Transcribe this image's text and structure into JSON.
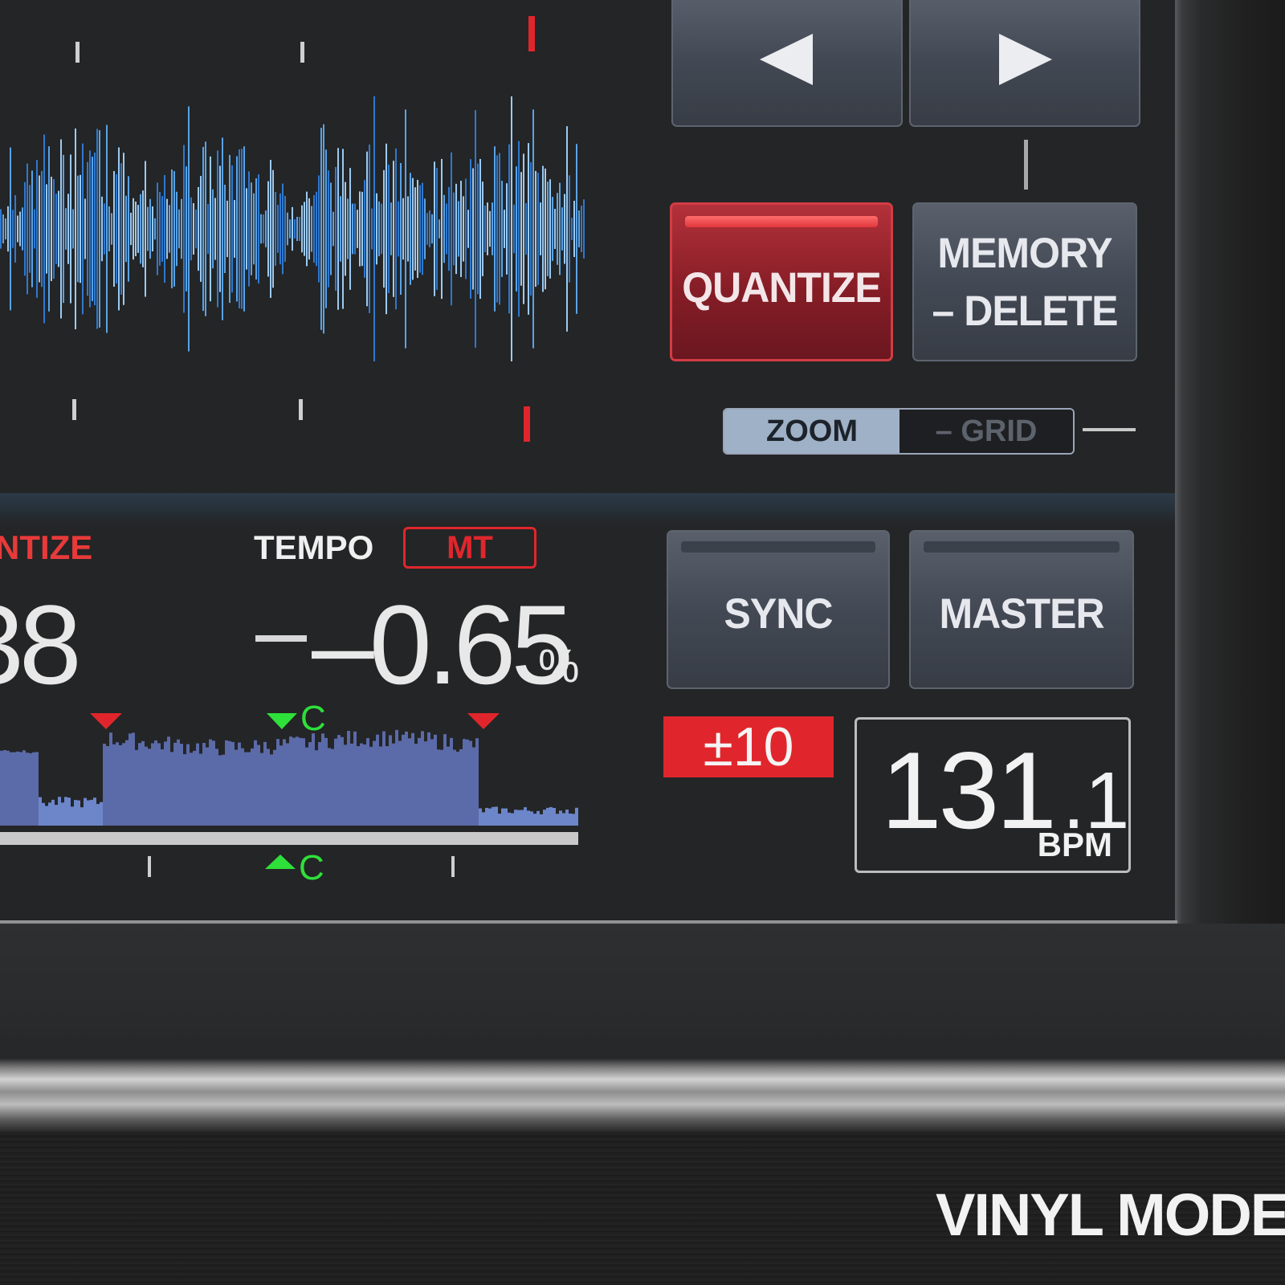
{
  "buttons": {
    "prev_icon": "left-triangle-icon",
    "next_icon": "right-triangle-icon",
    "quantize": "QUANTIZE",
    "memory_line1": "MEMORY",
    "memory_line2": "– DELETE",
    "sync": "SYNC",
    "master": "MASTER"
  },
  "zoom_grid": {
    "zoom": "ZOOM",
    "grid": "– GRID"
  },
  "status": {
    "quantize_label": "NTIZE",
    "tempo_label": "TEMPO",
    "mt_badge": "MT",
    "left_number": "38",
    "tempo_value": "–0.65",
    "tempo_unit": "%",
    "tempo_range": "±10",
    "bpm_integer": "131",
    "bpm_decimal": ".1",
    "bpm_unit": "BPM",
    "cue_marker_top": "C",
    "cue_marker_bottom": "C"
  },
  "footer": {
    "mode": "VINYL MODE"
  },
  "colors": {
    "accent_red": "#e0262c",
    "waveform_blue": "#4d8fd6",
    "overview_fill": "#5b6aa8",
    "cue_green": "#2ee03a"
  }
}
